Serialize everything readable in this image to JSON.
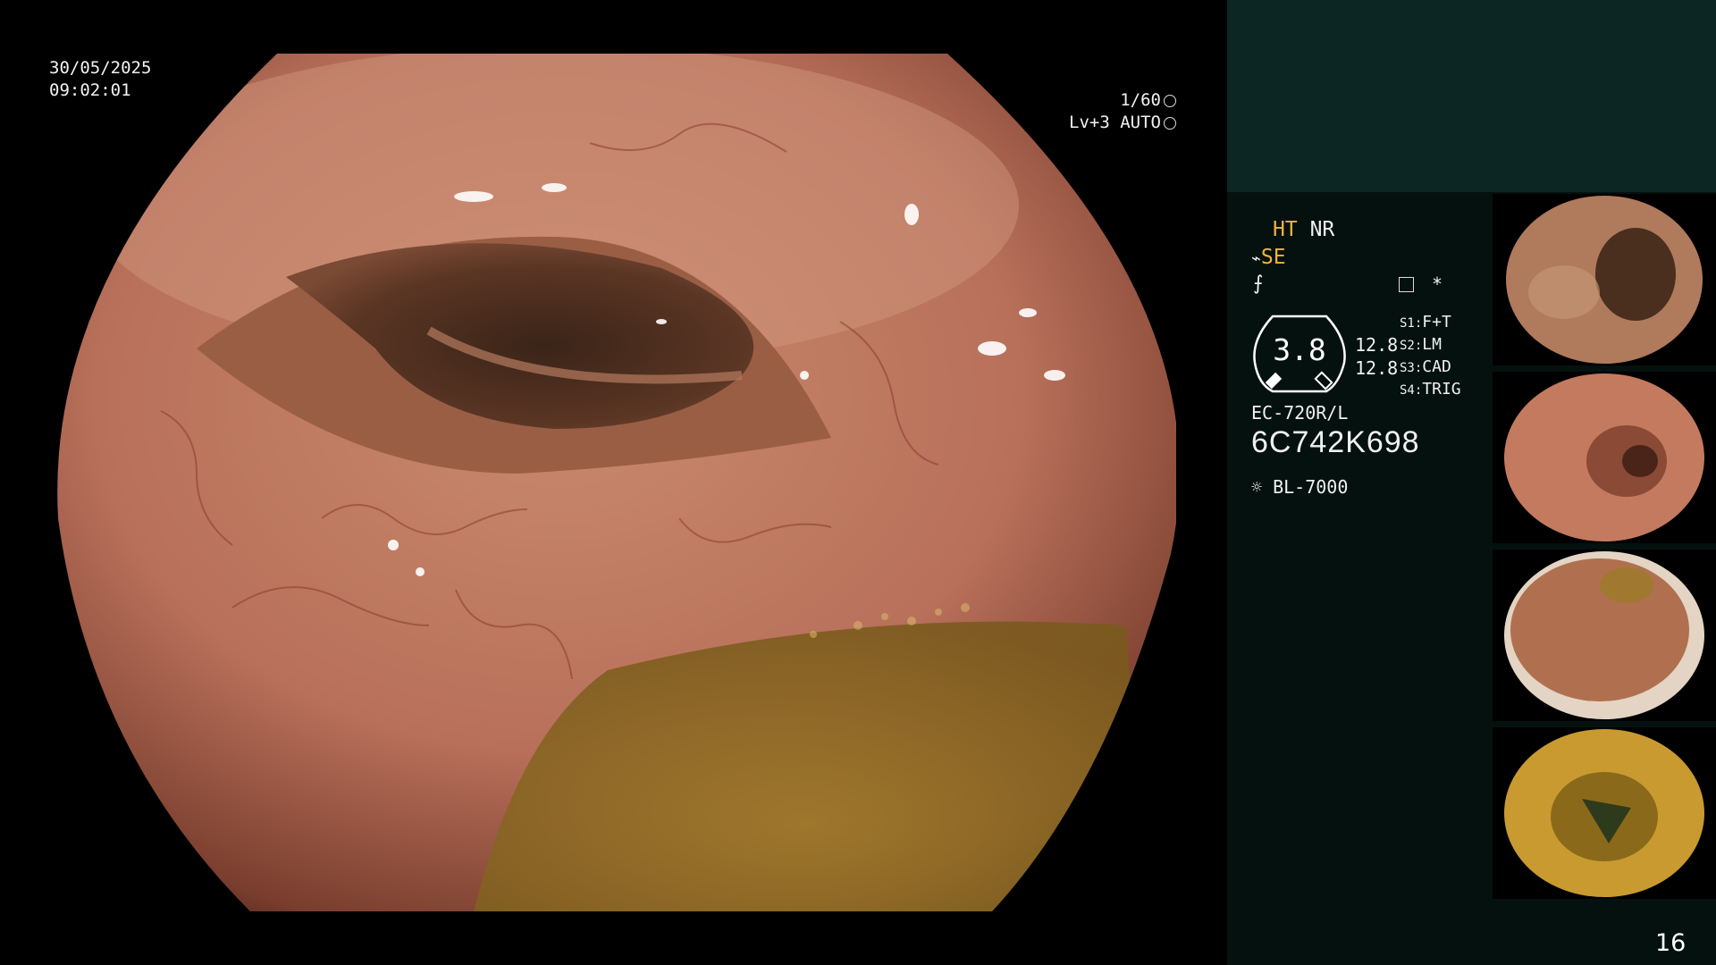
{
  "overlay": {
    "date": "30/05/2025",
    "time": "09:02:01",
    "shutter": "1/60",
    "iris": "Lv+3 AUTO"
  },
  "side_panel": {
    "ht_label": "HT",
    "nr_label": "NR",
    "se_label": "SE",
    "gauge_value": "3.8",
    "gauge_right_1": "12.8",
    "gauge_right_2": "12.8",
    "switches": [
      {
        "key": "S1:",
        "value": "F+T"
      },
      {
        "key": "S2:",
        "value": "LM"
      },
      {
        "key": "S3:",
        "value": "CAD"
      },
      {
        "key": "S4:",
        "value": "TRIG"
      }
    ],
    "asterisk": "*",
    "scope_model": "EC-720R/L",
    "scope_serial": "6C742K698",
    "light_source": "BL-7000",
    "page_number": "16"
  },
  "colors": {
    "highlight": "#f0b43c",
    "panel_bg": "#04110f",
    "panel_top_bg": "#0c2623"
  },
  "icons": [
    "shutter-icon",
    "iris-icon",
    "structure-icon",
    "edge-icon",
    "freeze-icon",
    "lamp-icon"
  ]
}
